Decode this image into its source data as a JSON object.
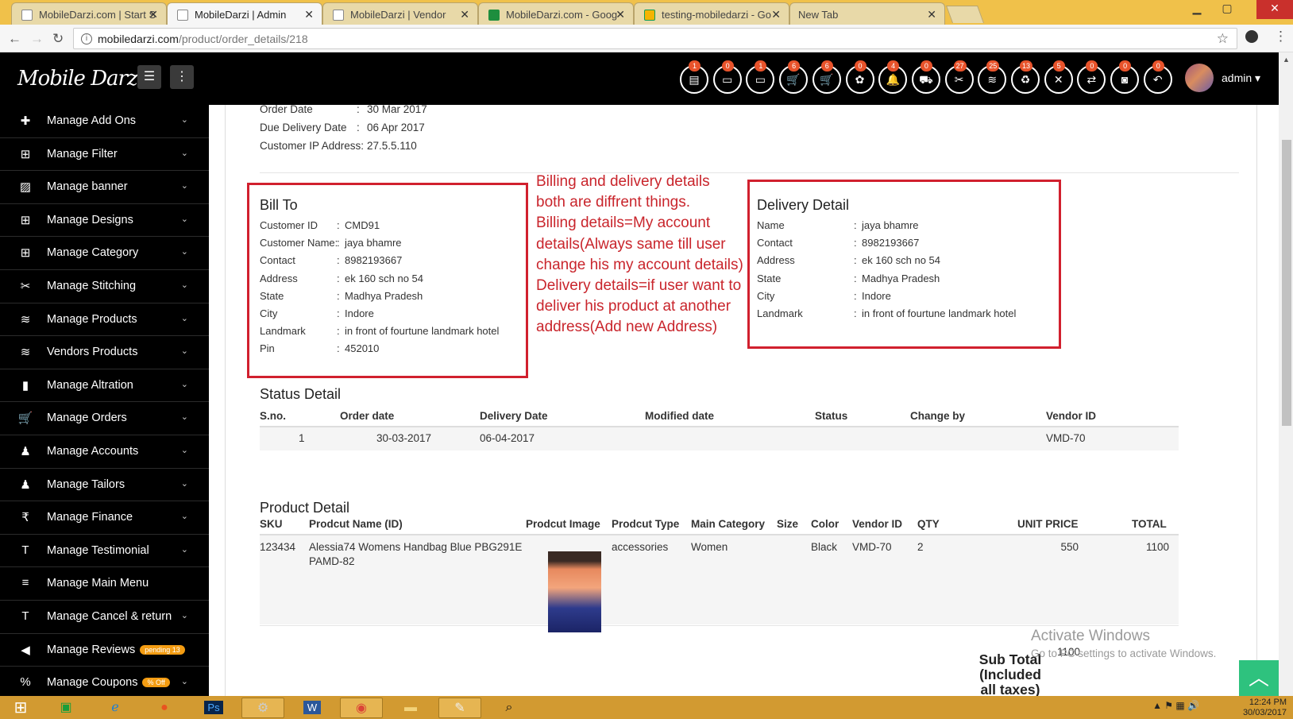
{
  "browser": {
    "tabs": [
      {
        "title": "MobileDarzi.com | Start S",
        "active": false
      },
      {
        "title": "MobileDarzi | Admin",
        "active": true
      },
      {
        "title": "MobileDarzi | Vendor",
        "active": false
      },
      {
        "title": "MobileDarzi.com - Goog",
        "active": false
      },
      {
        "title": "testing-mobiledarzi - Go",
        "active": false
      },
      {
        "title": "New Tab",
        "active": false
      }
    ],
    "url_domain": "mobiledarzi.com",
    "url_path": "/product/order_details/218"
  },
  "header": {
    "logo": "Mobile Darzi",
    "admin_label": "admin",
    "badges": [
      "1",
      "0",
      "1",
      "6",
      "6",
      "0",
      "4",
      "0",
      "27",
      "25",
      "13",
      "5",
      "0",
      "0",
      "0"
    ],
    "icons": [
      "notepad-icon",
      "id-card-icon",
      "id-card-alt-icon",
      "cart-icon",
      "cart-alt-icon",
      "gift-icon",
      "bell-icon",
      "truck-icon",
      "scissors-icon",
      "database-icon",
      "recycle-icon",
      "close-icon",
      "exchange-icon",
      "camera-icon",
      "reply-icon"
    ]
  },
  "sidebar": {
    "items": [
      {
        "label": "Manage Add Ons",
        "icon": "plus-icon"
      },
      {
        "label": "Manage Filter",
        "icon": "sitemap-icon"
      },
      {
        "label": "Manage banner",
        "icon": "image-icon"
      },
      {
        "label": "Manage Designs",
        "icon": "sitemap-icon"
      },
      {
        "label": "Manage Category",
        "icon": "sitemap-icon"
      },
      {
        "label": "Manage Stitching",
        "icon": "scissors-icon"
      },
      {
        "label": "Manage Products",
        "icon": "database-icon"
      },
      {
        "label": "Vendors Products",
        "icon": "database-icon"
      },
      {
        "label": "Manage Altration",
        "icon": "bookmark-icon"
      },
      {
        "label": "Manage Orders",
        "icon": "cart-icon"
      },
      {
        "label": "Manage Accounts",
        "icon": "user-plus-icon"
      },
      {
        "label": "Manage Tailors",
        "icon": "user-plus-icon"
      },
      {
        "label": "Manage Finance",
        "icon": "rupee-icon"
      },
      {
        "label": "Manage Testimonial",
        "icon": "text-icon"
      },
      {
        "label": "Manage Main Menu",
        "icon": "menu-icon"
      },
      {
        "label": "Manage Cancel & return",
        "icon": "text-icon"
      },
      {
        "label": "Manage Reviews",
        "icon": "megaphone-icon",
        "pill": "pending 13"
      },
      {
        "label": "Manage Coupons",
        "icon": "percent-icon",
        "pill": "% Off"
      }
    ]
  },
  "order": {
    "order_date_label": "Order Date",
    "order_date": "30 Mar 2017",
    "due_label": "Due Delivery Date",
    "due": "06 Apr 2017",
    "ip_label": "Customer IP Address:",
    "ip": "27.5.5.110"
  },
  "bill_to": {
    "title": "Bill To",
    "rows": [
      {
        "k": "Customer ID",
        "v": "CMD91"
      },
      {
        "k": "Customer Name:",
        "v": "jaya bhamre"
      },
      {
        "k": "Contact",
        "v": "8982193667"
      },
      {
        "k": "Address",
        "v": "ek 160 sch no 54"
      },
      {
        "k": "State",
        "v": "Madhya Pradesh"
      },
      {
        "k": "City",
        "v": "Indore"
      },
      {
        "k": "Landmark",
        "v": "in front of fourtune landmark hotel"
      },
      {
        "k": "Pin",
        "v": "452010"
      }
    ]
  },
  "delivery": {
    "title": "Delivery Detail",
    "rows": [
      {
        "k": "Name",
        "v": "jaya bhamre"
      },
      {
        "k": "Contact",
        "v": "8982193667"
      },
      {
        "k": "Address",
        "v": "ek 160 sch no 54"
      },
      {
        "k": "State",
        "v": "Madhya Pradesh"
      },
      {
        "k": "City",
        "v": "Indore"
      },
      {
        "k": "Landmark",
        "v": "in front of fourtune landmark hotel"
      }
    ]
  },
  "annotation": {
    "lines": [
      "Billing and delivery details",
      "both are diffrent things.",
      "Billing details=My account",
      "details(Always same till user",
      "change his my account details)",
      "Delivery details=if user want to",
      "deliver his product at another",
      "address(Add new Address)"
    ]
  },
  "status": {
    "title": "Status Detail",
    "headers": [
      "S.no.",
      "Order date",
      "Delivery Date",
      "Modified date",
      "Status",
      "Change by",
      "Vendor ID"
    ],
    "row": [
      "1",
      "30-03-2017",
      "06-04-2017",
      "",
      "",
      "",
      "VMD-70"
    ]
  },
  "product": {
    "title": "Product Detail",
    "headers": [
      "SKU",
      "Prodcut Name (ID)",
      "Prodcut Image",
      "Prodcut Type",
      "Main Category",
      "Size",
      "Color",
      "Vendor ID",
      "QTY",
      "UNIT PRICE",
      "TOTAL"
    ],
    "row": {
      "sku": "123434",
      "name_line1": "Alessia74 Womens Handbag Blue PBG291E",
      "name_line2": "PAMD-82",
      "type": "accessories",
      "category": "Women",
      "size": "",
      "color": "Black",
      "vendor": "VMD-70",
      "qty": "2",
      "unit_price": "550",
      "total": "1100"
    },
    "subtotal_label": "Sub Total (Included all taxes)",
    "subtotal_value": "1100"
  },
  "watermark": {
    "line1": "Activate Windows",
    "line2": "Go to PC settings to activate Windows."
  },
  "taskbar": {
    "time": "12:24 PM",
    "date": "30/03/2017"
  }
}
